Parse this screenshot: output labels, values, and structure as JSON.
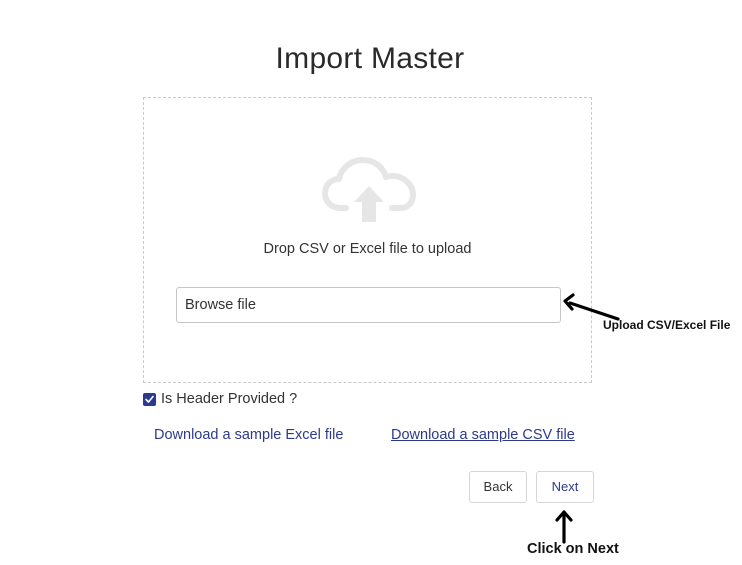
{
  "page": {
    "title": "Import Master"
  },
  "upload": {
    "icon": "cloud-upload-icon",
    "drop_text": "Drop CSV or Excel file to upload",
    "browse_label": "Browse file"
  },
  "options": {
    "header_checkbox_label": "Is Header Provided ?",
    "header_checked": true
  },
  "links": {
    "sample_excel": "Download a sample Excel file",
    "sample_csv": "Download a sample CSV file"
  },
  "buttons": {
    "back": "Back",
    "next": "Next"
  },
  "annotations": {
    "upload_hint": "Upload CSV/Excel File",
    "next_hint": "Click on Next"
  },
  "colors": {
    "accent": "#2b3a8c",
    "icon_gray": "#e6e6e6",
    "border_dashed": "#c9c9c9"
  }
}
